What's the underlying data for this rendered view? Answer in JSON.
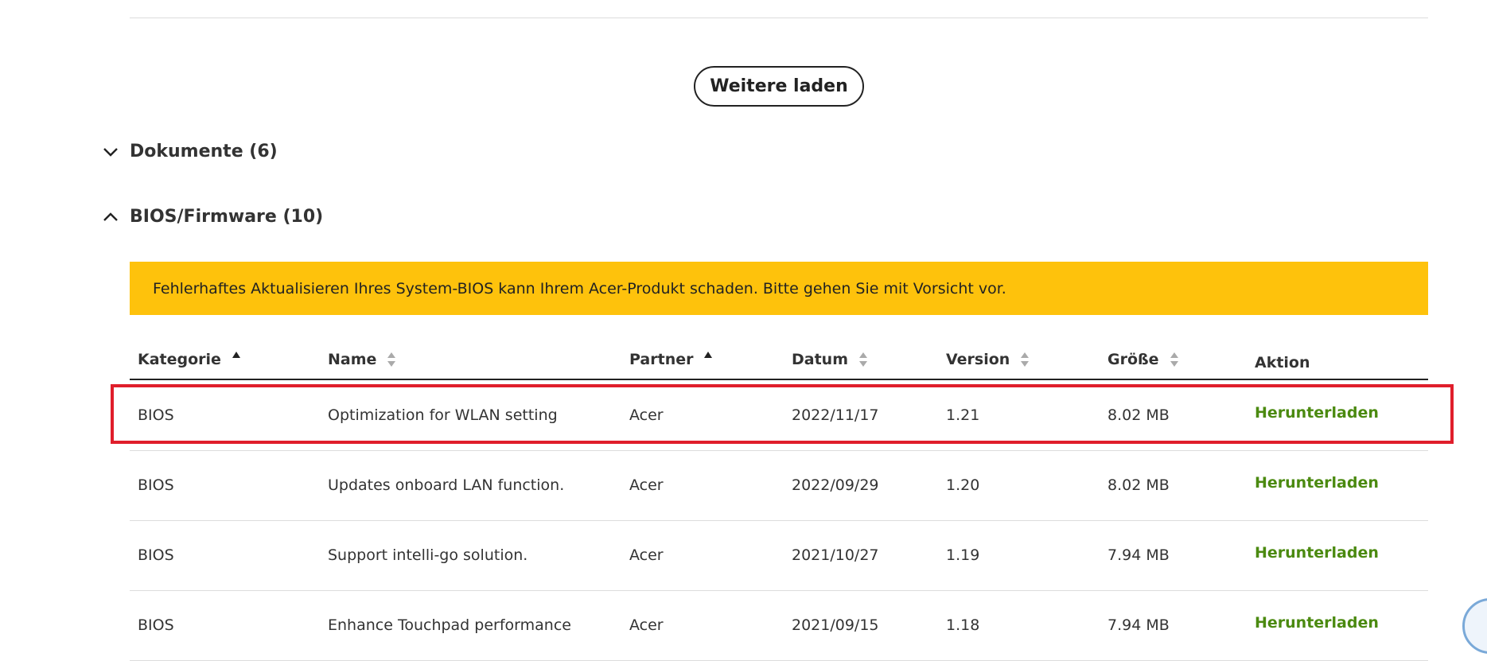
{
  "load_more_label": "Weitere laden",
  "sections": [
    {
      "title": "Dokumente (6)",
      "expanded": false
    },
    {
      "title": "BIOS/Firmware (10)",
      "expanded": true
    }
  ],
  "warning_text": "Fehlerhaftes Aktualisieren Ihres System-BIOS kann Ihrem Acer-Produkt schaden. Bitte gehen Sie mit Vorsicht vor.",
  "warning_color": "#fec20c",
  "accent_link_color": "#4b8a10",
  "highlight_color": "#e01e2b",
  "table": {
    "headers": {
      "kategorie": "Kategorie",
      "name": "Name",
      "partner": "Partner",
      "datum": "Datum",
      "version": "Version",
      "groesse": "Größe",
      "aktion": "Aktion"
    },
    "rows": [
      {
        "kategorie": "BIOS",
        "name": "Optimization for WLAN setting",
        "partner": "Acer",
        "datum": "2022/11/17",
        "version": "1.21",
        "groesse": "8.02 MB",
        "aktion": "Herunterladen",
        "highlighted": true
      },
      {
        "kategorie": "BIOS",
        "name": "Updates onboard LAN function.",
        "partner": "Acer",
        "datum": "2022/09/29",
        "version": "1.20",
        "groesse": "8.02 MB",
        "aktion": "Herunterladen"
      },
      {
        "kategorie": "BIOS",
        "name": "Support intelli-go solution.",
        "partner": "Acer",
        "datum": "2021/10/27",
        "version": "1.19",
        "groesse": "7.94 MB",
        "aktion": "Herunterladen"
      },
      {
        "kategorie": "BIOS",
        "name": "Enhance Touchpad performance",
        "partner": "Acer",
        "datum": "2021/09/15",
        "version": "1.18",
        "groesse": "7.94 MB",
        "aktion": "Herunterladen"
      }
    ]
  }
}
